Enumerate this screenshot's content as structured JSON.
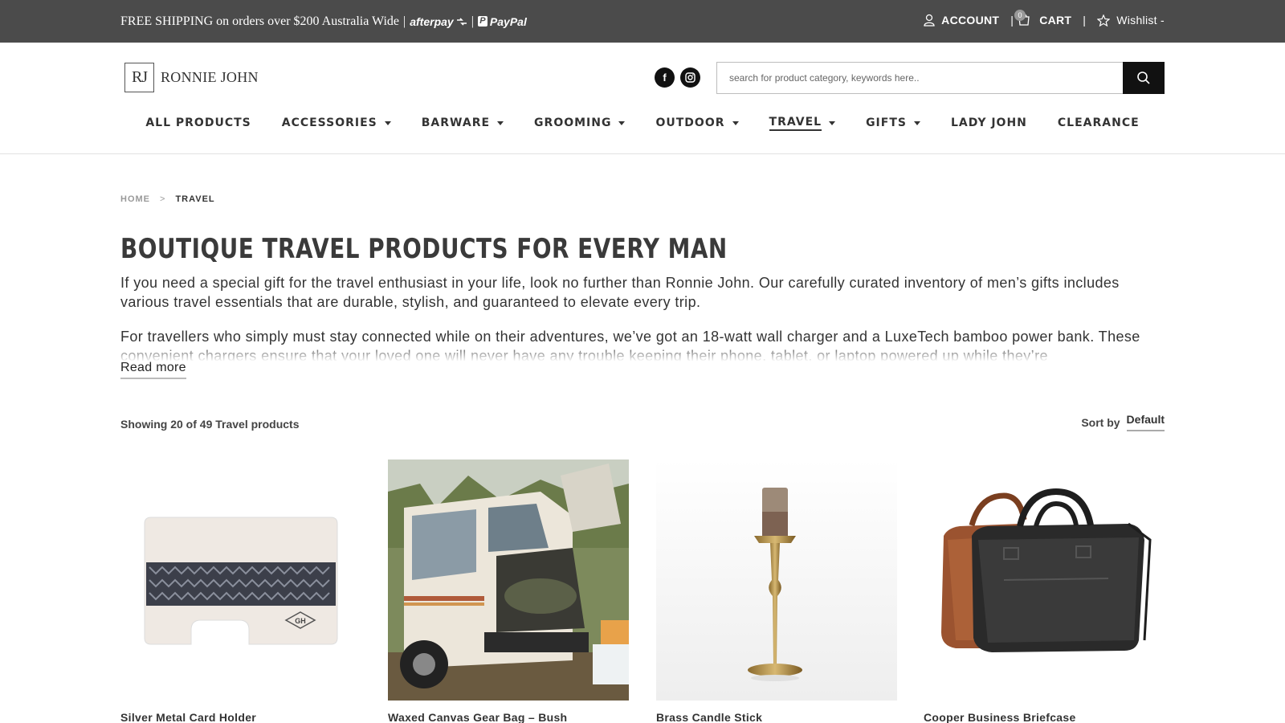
{
  "topbar": {
    "promo_text": "FREE SHIPPING on orders over $200 Australia Wide",
    "sep": "|",
    "afterpay": "afterpay",
    "paypal": "PayPal",
    "account_label": "ACCOUNT",
    "cart_label": "CART",
    "cart_count": "0",
    "pipe": "|",
    "wishlist_label": "Wishlist -"
  },
  "header": {
    "logo_mark": "RJ",
    "logo_text": "RONNIE JOHN",
    "search_placeholder": "search for product category, keywords here.."
  },
  "nav": {
    "items": [
      {
        "label": "ALL PRODUCTS",
        "dropdown": false
      },
      {
        "label": "ACCESSORIES",
        "dropdown": true
      },
      {
        "label": "BARWARE",
        "dropdown": true
      },
      {
        "label": "GROOMING",
        "dropdown": true
      },
      {
        "label": "OUTDOOR",
        "dropdown": true
      },
      {
        "label": "TRAVEL",
        "dropdown": true,
        "active": true
      },
      {
        "label": "GIFTS",
        "dropdown": true
      },
      {
        "label": "LADY JOHN",
        "dropdown": false
      },
      {
        "label": "CLEARANCE",
        "dropdown": false
      }
    ]
  },
  "breadcrumb": {
    "home": "HOME",
    "separator": ">",
    "current": "TRAVEL"
  },
  "content": {
    "title": "BOUTIQUE TRAVEL PRODUCTS FOR EVERY MAN",
    "paragraph_1": "If you need a special gift for the travel enthusiast in your life, look no further than Ronnie John. Our carefully curated inventory of men’s gifts includes various travel essentials that are durable, stylish, and guaranteed to elevate every trip.",
    "paragraph_2": "For travellers who simply must stay connected while on their adventures, we’ve got an 18-watt wall charger and a LuxeTech bamboo power bank. These convenient chargers ensure that your loved one will never have any trouble keeping their phone, tablet, or laptop powered up while they’re",
    "read_more": "Read more"
  },
  "results": {
    "showing": "Showing 20 of 49 Travel products",
    "sort_label": "Sort by",
    "sort_value": "Default"
  },
  "products": [
    {
      "name": "Silver Metal Card Holder"
    },
    {
      "name": "Waxed Canvas Gear Bag – Bush"
    },
    {
      "name": "Brass Candle Stick"
    },
    {
      "name": "Cooper Business Briefcase"
    }
  ],
  "colors": {
    "topbar_bg": "#4b4b4b",
    "text_dark": "#333333",
    "search_button": "#111111"
  }
}
